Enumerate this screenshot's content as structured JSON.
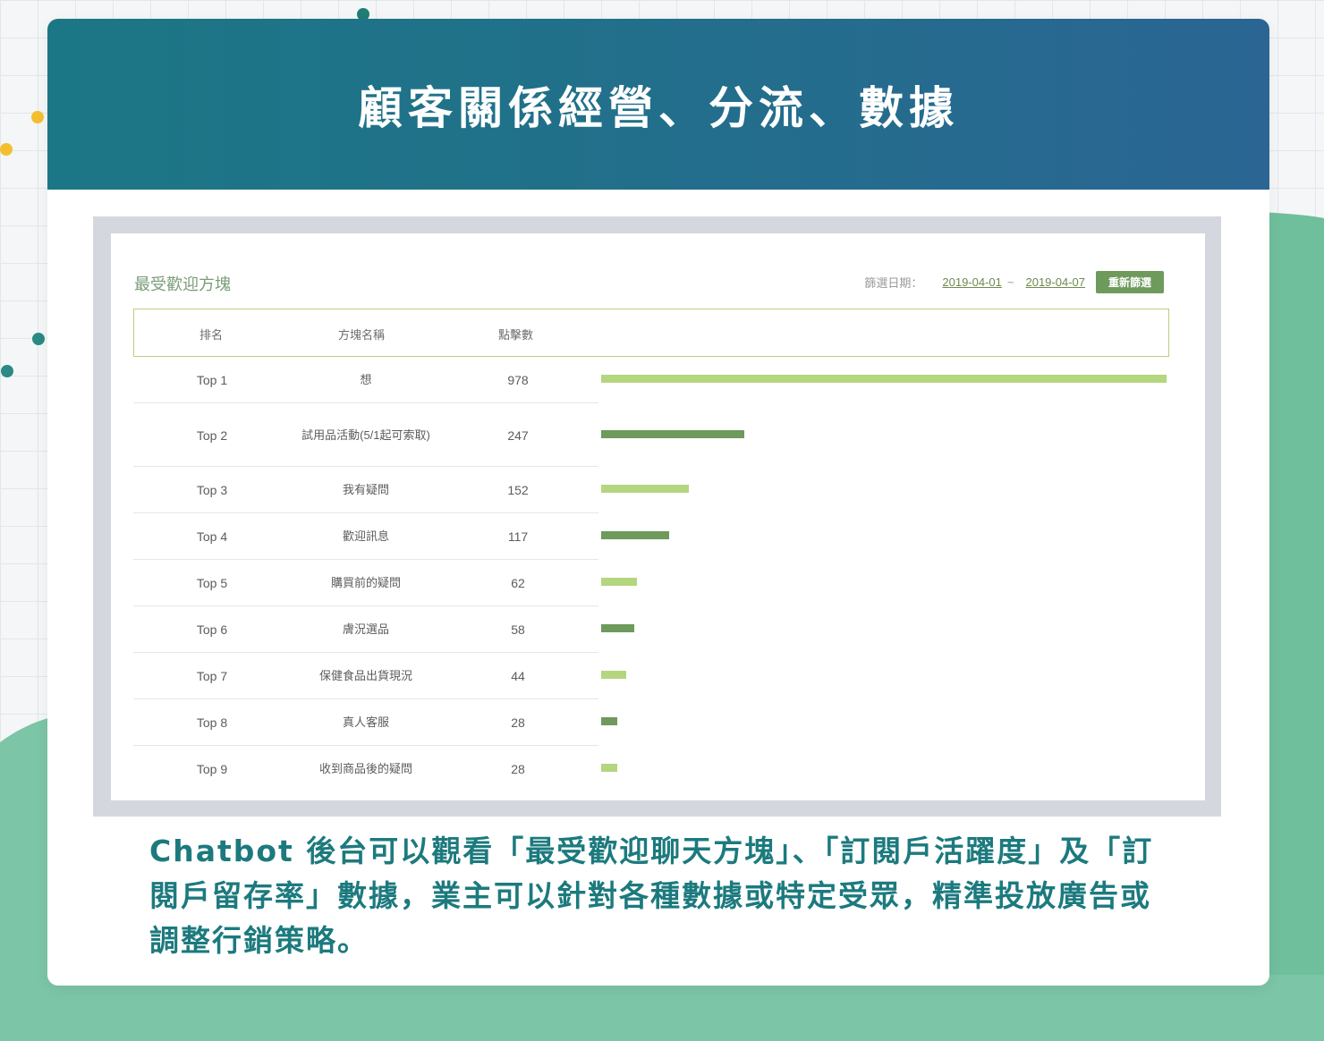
{
  "header": {
    "title": "顧客關係經營、分流、數據"
  },
  "panel": {
    "title": "最受歡迎方塊",
    "filter_label": "篩選日期：",
    "date_from": "2019-04-01",
    "separator": "~",
    "date_to": "2019-04-07",
    "refilter_label": "重新篩選"
  },
  "table": {
    "columns": [
      "排名",
      "方塊名稱",
      "點擊數"
    ],
    "rows": [
      {
        "rank": "Top 1",
        "name": "想",
        "clicks": "978"
      },
      {
        "rank": "Top 2",
        "name": "試用品活動(5/1起可索取)",
        "clicks": "247"
      },
      {
        "rank": "Top 3",
        "name": "我有疑問",
        "clicks": "152"
      },
      {
        "rank": "Top 4",
        "name": "歡迎訊息",
        "clicks": "117"
      },
      {
        "rank": "Top 5",
        "name": "購買前的疑問",
        "clicks": "62"
      },
      {
        "rank": "Top 6",
        "name": "膚況選品",
        "clicks": "58"
      },
      {
        "rank": "Top 7",
        "name": "保健食品出貨現況",
        "clicks": "44"
      },
      {
        "rank": "Top 8",
        "name": "真人客服",
        "clicks": "28"
      },
      {
        "rank": "Top 9",
        "name": "收到商品後的疑問",
        "clicks": "28"
      }
    ]
  },
  "chart_data": {
    "type": "bar",
    "categories": [
      "Top 1",
      "Top 2",
      "Top 3",
      "Top 4",
      "Top 5",
      "Top 6",
      "Top 7",
      "Top 8",
      "Top 9"
    ],
    "values": [
      978,
      247,
      152,
      117,
      62,
      58,
      44,
      28,
      28
    ],
    "bar_colors": [
      "#b3d67e",
      "#6e9a5c",
      "#b3d67e",
      "#6e9a5c",
      "#b3d67e",
      "#6e9a5c",
      "#b3d67e",
      "#6e9a5c",
      "#b3d67e"
    ],
    "max": 978
  },
  "caption": {
    "text": "Chatbot 後台可以觀看「最受歡迎聊天方塊」、「訂閱戶活躍度」及「訂閱戶留存率」數據，業主可以針對各種數據或特定受眾，精準投放廣告或調整行銷策略。"
  },
  "colors": {
    "header_start": "#1b7785",
    "header_end": "#2a6593",
    "accent_green": "#6e9a5c",
    "light_green": "#b3d67e",
    "caption": "#1c7a7e",
    "wave": "#7cc5a6"
  }
}
